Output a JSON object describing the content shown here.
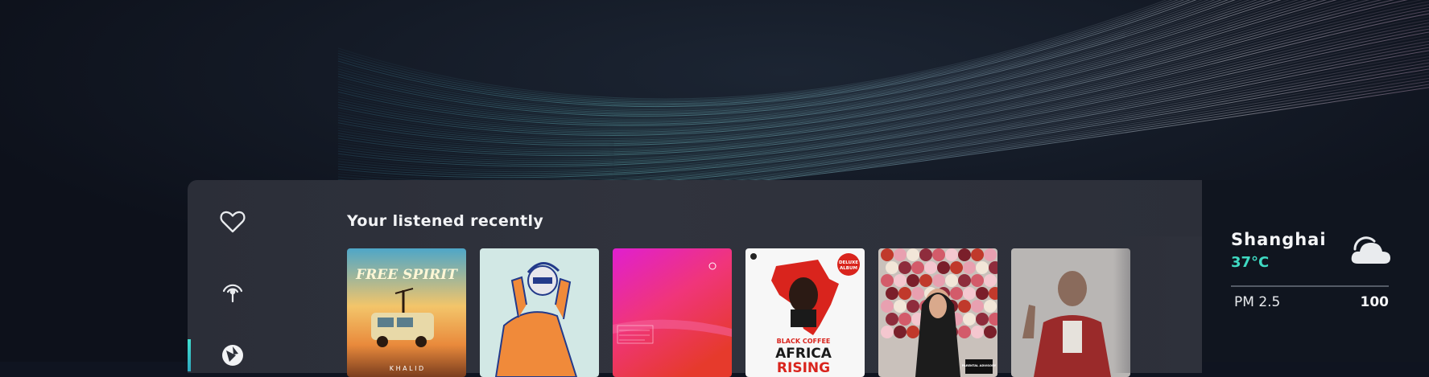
{
  "sidebar": {
    "items": [
      {
        "name": "favorites",
        "icon": "heart-icon"
      },
      {
        "name": "radio",
        "icon": "broadcast-icon"
      },
      {
        "name": "discover",
        "icon": "aperture-icon",
        "active": true
      }
    ],
    "accent_color": "#3fe0d0"
  },
  "recent": {
    "title": "Your listened recently",
    "albums": [
      {
        "title_lines": [
          "FREE SPIRIT"
        ],
        "artist": "K H A L I D"
      },
      {
        "title_lines": [],
        "artist": ""
      },
      {
        "title_lines": [],
        "artist": ""
      },
      {
        "title_lines": [
          "BLACK COFFEE",
          "AFRICA",
          "RISING"
        ],
        "badge_lines": [
          "DELUXE",
          "ALBUM"
        ]
      },
      {
        "title_lines": [],
        "artist": "",
        "label": "PARENTAL ADVISORY"
      },
      {
        "title_lines": [],
        "artist": ""
      }
    ]
  },
  "weather": {
    "city": "Shanghai",
    "temperature": "37°C",
    "temp_color": "#3fd9c2",
    "condition_icon": "partly-cloudy-icon",
    "pm_label": "PM 2.5",
    "pm_value": "100"
  }
}
